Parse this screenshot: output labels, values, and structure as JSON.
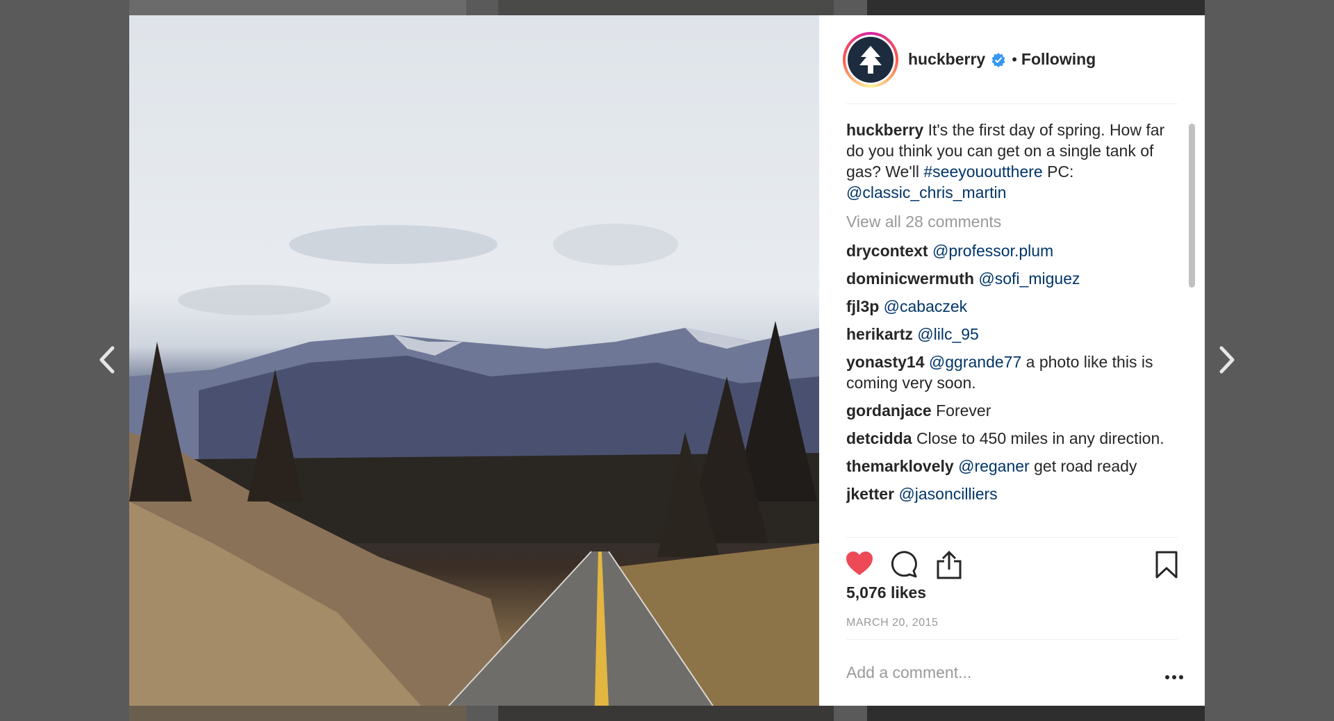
{
  "post": {
    "username": "huckberry",
    "separator": "•",
    "follow_status": "Following",
    "caption_user": "huckberry",
    "caption_text": " It's the first day of spring. How far do you think you can get on a single tank of gas? We'll ",
    "caption_hashtag": "#seeyououtthere",
    "caption_pc": " PC: ",
    "caption_mention": "@classic_chris_martin",
    "view_all": "View all 28 comments",
    "likes": "5,076 likes",
    "date": "MARCH 20, 2015",
    "add_comment_placeholder": "Add a comment..."
  },
  "comments": [
    {
      "user": "drycontext",
      "mention": "@professor.plum",
      "text": ""
    },
    {
      "user": "dominicwermuth",
      "mention": "@sofi_miguez",
      "text": ""
    },
    {
      "user": "fjl3p",
      "mention": "@cabaczek",
      "text": ""
    },
    {
      "user": "herikartz",
      "mention": "@lilc_95",
      "text": ""
    },
    {
      "user": "yonasty14",
      "mention": "@ggrande77",
      "text": " a photo like this is coming very soon."
    },
    {
      "user": "gordanjace",
      "mention": "",
      "text": " Forever"
    },
    {
      "user": "detcidda",
      "mention": "",
      "text": " Close to 450 miles in any direction."
    },
    {
      "user": "themarklovely",
      "mention": "@reganer",
      "text": " get road ready"
    },
    {
      "user": "jketter",
      "mention": "@jasoncilliers",
      "text": ""
    }
  ],
  "icons": {
    "prev": "chevron-left-icon",
    "next": "chevron-right-icon",
    "like": "heart-filled-icon",
    "comment": "comment-bubble-icon",
    "share": "share-icon",
    "save": "bookmark-icon",
    "verified": "verified-badge-icon",
    "more": "more-options-icon"
  },
  "colors": {
    "like": "#ed4956",
    "link": "#003569",
    "verified": "#3897f0",
    "muted": "#999999"
  }
}
